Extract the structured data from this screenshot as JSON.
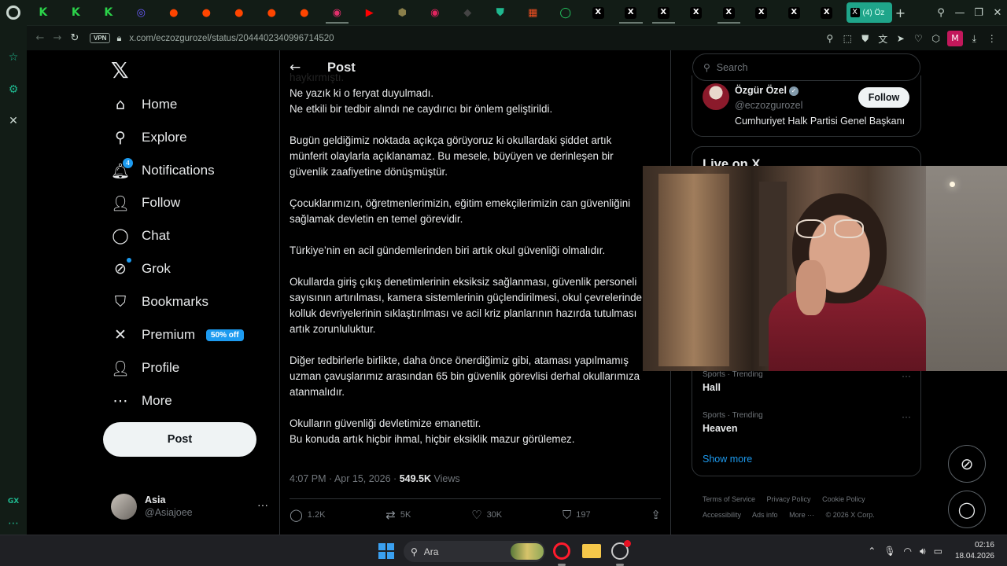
{
  "browser": {
    "url": "x.com/eczozgurozel/status/2044402340996714520",
    "vpn_label": "VPN",
    "active_tab_label": "(4) Öz",
    "tab_icons": [
      {
        "name": "k-tab-icon",
        "glyph": "K",
        "color": "#2bd34a",
        "underline": false
      },
      {
        "name": "k-tab-icon",
        "glyph": "K",
        "color": "#2bd34a",
        "underline": false
      },
      {
        "name": "k-tab-icon",
        "glyph": "K",
        "color": "#2bd34a",
        "underline": false
      },
      {
        "name": "app-tab-icon",
        "glyph": "◎",
        "color": "#6a5cff",
        "underline": false
      },
      {
        "name": "reddit-tab-icon",
        "glyph": "●",
        "color": "#ff4500",
        "underline": false
      },
      {
        "name": "reddit-tab-icon",
        "glyph": "●",
        "color": "#ff4500",
        "underline": false
      },
      {
        "name": "reddit-tab-icon",
        "glyph": "●",
        "color": "#ff4500",
        "underline": false
      },
      {
        "name": "reddit-tab-icon",
        "glyph": "●",
        "color": "#ff4500",
        "underline": false
      },
      {
        "name": "reddit-tab-icon",
        "glyph": "●",
        "color": "#ff4500",
        "underline": false
      },
      {
        "name": "instagram-tab-icon",
        "glyph": "◉",
        "color": "#e1306c",
        "underline": true
      },
      {
        "name": "youtube-tab-icon",
        "glyph": "▶",
        "color": "#ff0000",
        "underline": false
      },
      {
        "name": "app-tab-icon",
        "glyph": "⬢",
        "color": "#8a7f4a",
        "underline": false
      },
      {
        "name": "app-tab-icon",
        "glyph": "◉",
        "color": "#e0245e",
        "underline": false
      },
      {
        "name": "app-tab-icon",
        "glyph": "◆",
        "color": "#444444",
        "underline": false
      },
      {
        "name": "shield-tab-icon",
        "glyph": "⛊",
        "color": "#1fb88f",
        "underline": false
      },
      {
        "name": "microsoft-tab-icon",
        "glyph": "▦",
        "color": "#f25022",
        "underline": false
      },
      {
        "name": "whatsapp-tab-icon",
        "glyph": "◯",
        "color": "#25d366",
        "underline": false
      },
      {
        "name": "x-tab-icon",
        "glyph": "X",
        "color": "#000000",
        "underline": false
      },
      {
        "name": "x-tab-icon",
        "glyph": "X",
        "color": "#000000",
        "underline": true
      },
      {
        "name": "x-tab-icon",
        "glyph": "X",
        "color": "#000000",
        "underline": true
      },
      {
        "name": "x-tab-icon",
        "glyph": "X",
        "color": "#000000",
        "underline": false
      },
      {
        "name": "x-tab-icon",
        "glyph": "X",
        "color": "#000000",
        "underline": true
      },
      {
        "name": "x-tab-icon",
        "glyph": "X",
        "color": "#000000",
        "underline": false
      },
      {
        "name": "x-tab-icon",
        "glyph": "X",
        "color": "#000000",
        "underline": false
      },
      {
        "name": "x-tab-icon",
        "glyph": "X",
        "color": "#000000",
        "underline": false
      }
    ]
  },
  "nav": {
    "items": [
      {
        "label": "Home",
        "icon": "home-icon",
        "glyph": "⌂"
      },
      {
        "label": "Explore",
        "icon": "search-icon",
        "glyph": "⚲"
      },
      {
        "label": "Notifications",
        "icon": "bell-icon",
        "glyph": "🔔︎"
      },
      {
        "label": "Follow",
        "icon": "follow-icon",
        "glyph": "👤︎"
      },
      {
        "label": "Chat",
        "icon": "chat-icon",
        "glyph": "◯"
      },
      {
        "label": "Grok",
        "icon": "grok-icon",
        "glyph": "⊘"
      },
      {
        "label": "Bookmarks",
        "icon": "bookmark-icon",
        "glyph": "⛉"
      },
      {
        "label": "Premium",
        "icon": "x-icon",
        "glyph": "✕"
      },
      {
        "label": "Profile",
        "icon": "profile-icon",
        "glyph": "👤︎"
      },
      {
        "label": "More",
        "icon": "more-icon",
        "glyph": "⋯"
      }
    ],
    "notifications_badge": "4",
    "premium_badge": "50% off",
    "post_button": "Post"
  },
  "account": {
    "display_name": "Asia",
    "handle": "@Asiajoee"
  },
  "post": {
    "header_title": "Post",
    "paragraphs": [
      [
        "haykırmıştı.",
        "Ne yazık ki o feryat duyulmadı.",
        "Ne etkili bir tedbir alındı ne caydırıcı bir önlem geliştirildi."
      ],
      [
        "Bugün geldiğimiz noktada açıkça görüyoruz ki okullardaki şiddet artık",
        "münferit olaylarla açıklanamaz. Bu mesele, büyüyen ve derinleşen bir",
        "güvenlik zaafiyetine dönüşmüştür."
      ],
      [
        "Çocuklarımızın, öğretmenlerimizin, eğitim emekçilerimizin can güvenliğini",
        "sağlamak devletin en temel görevidir."
      ],
      [
        "Türkiye’nin en acil gündemlerinden biri artık okul güvenliği olmalıdır."
      ],
      [
        "Okullarda giriş çıkış denetimlerinin eksiksiz sağlanması, güvenlik personeli",
        "sayısının artırılması, kamera sistemlerinin güçlendirilmesi, okul çevrelerinde",
        "kolluk devriyelerinin sıklaştırılması ve acil kriz planlarının hazırda tutulması",
        "artık zorunluluktur."
      ],
      [
        "Diğer tedbirlerle birlikte, daha önce önerdiğimiz gibi, ataması yapılmamış",
        "uzman çavuşlarımız arasından 65 bin güvenlik görevlisi derhal okullarımıza",
        "atanmalıdır."
      ],
      [
        "Okulların güvenliği devletimize emanettir.",
        "Bu konuda artık hiçbir ihmal, hiçbir eksiklik mazur görülemez."
      ]
    ],
    "timestamp": "4:07 PM · Apr 15, 2026 ·",
    "views_count": "549.5K",
    "views_label": "Views",
    "replies": "1.2K",
    "reposts": "5K",
    "likes": "30K",
    "bookmarks": "197"
  },
  "right": {
    "search_placeholder": "Search",
    "profile": {
      "name": "Özgür Özel",
      "handle": "@eczozgurozel",
      "bio": "Cumhuriyet Halk Partisi Genel Başkanı",
      "follow_label": "Follow"
    },
    "live_title": "Live on X",
    "trends": [
      {
        "meta": "Sports · Trending",
        "name": "Hall"
      },
      {
        "meta": "Sports · Trending",
        "name": "Heaven"
      }
    ],
    "show_more": "Show more",
    "footer": [
      "Terms of Service",
      "Privacy Policy",
      "Cookie Policy",
      "Accessibility",
      "Ads info",
      "More ···",
      "© 2026 X Corp."
    ]
  },
  "taskbar": {
    "search_label": "Ara",
    "time": "02:16",
    "date": "18.04.2026"
  }
}
